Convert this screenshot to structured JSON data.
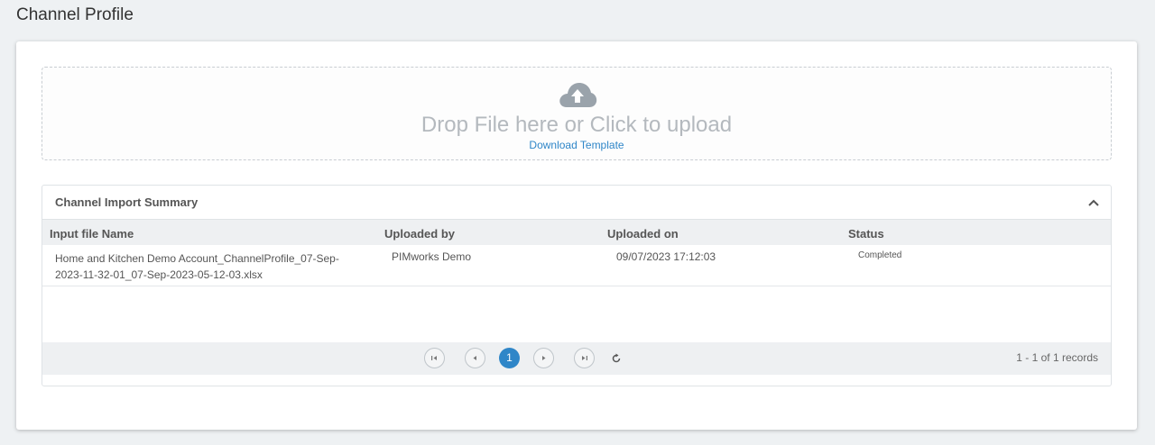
{
  "page": {
    "title": "Channel Profile"
  },
  "upload": {
    "icon": "cloud-upload-icon",
    "prompt": "Drop File here or Click to upload",
    "download_label": "Download Template"
  },
  "summary": {
    "title": "Channel Import Summary",
    "columns": [
      "Input file Name",
      "Uploaded by",
      "Uploaded on",
      "Status"
    ],
    "rows": [
      {
        "file_name_line1": "Home and Kitchen Demo Account_ChannelProfile_07-Sep-",
        "file_name_line2": "2023-11-32-01_07-Sep-2023-05-12-03.xlsx",
        "uploaded_by": "PIMworks Demo",
        "uploaded_on": "09/07/2023 17:12:03",
        "status": "Completed"
      }
    ]
  },
  "pager": {
    "current_page": "1",
    "info": "1 - 1 of 1 records"
  },
  "colors": {
    "accent": "#2f86c8",
    "icon_gray": "#9aa3ab"
  }
}
